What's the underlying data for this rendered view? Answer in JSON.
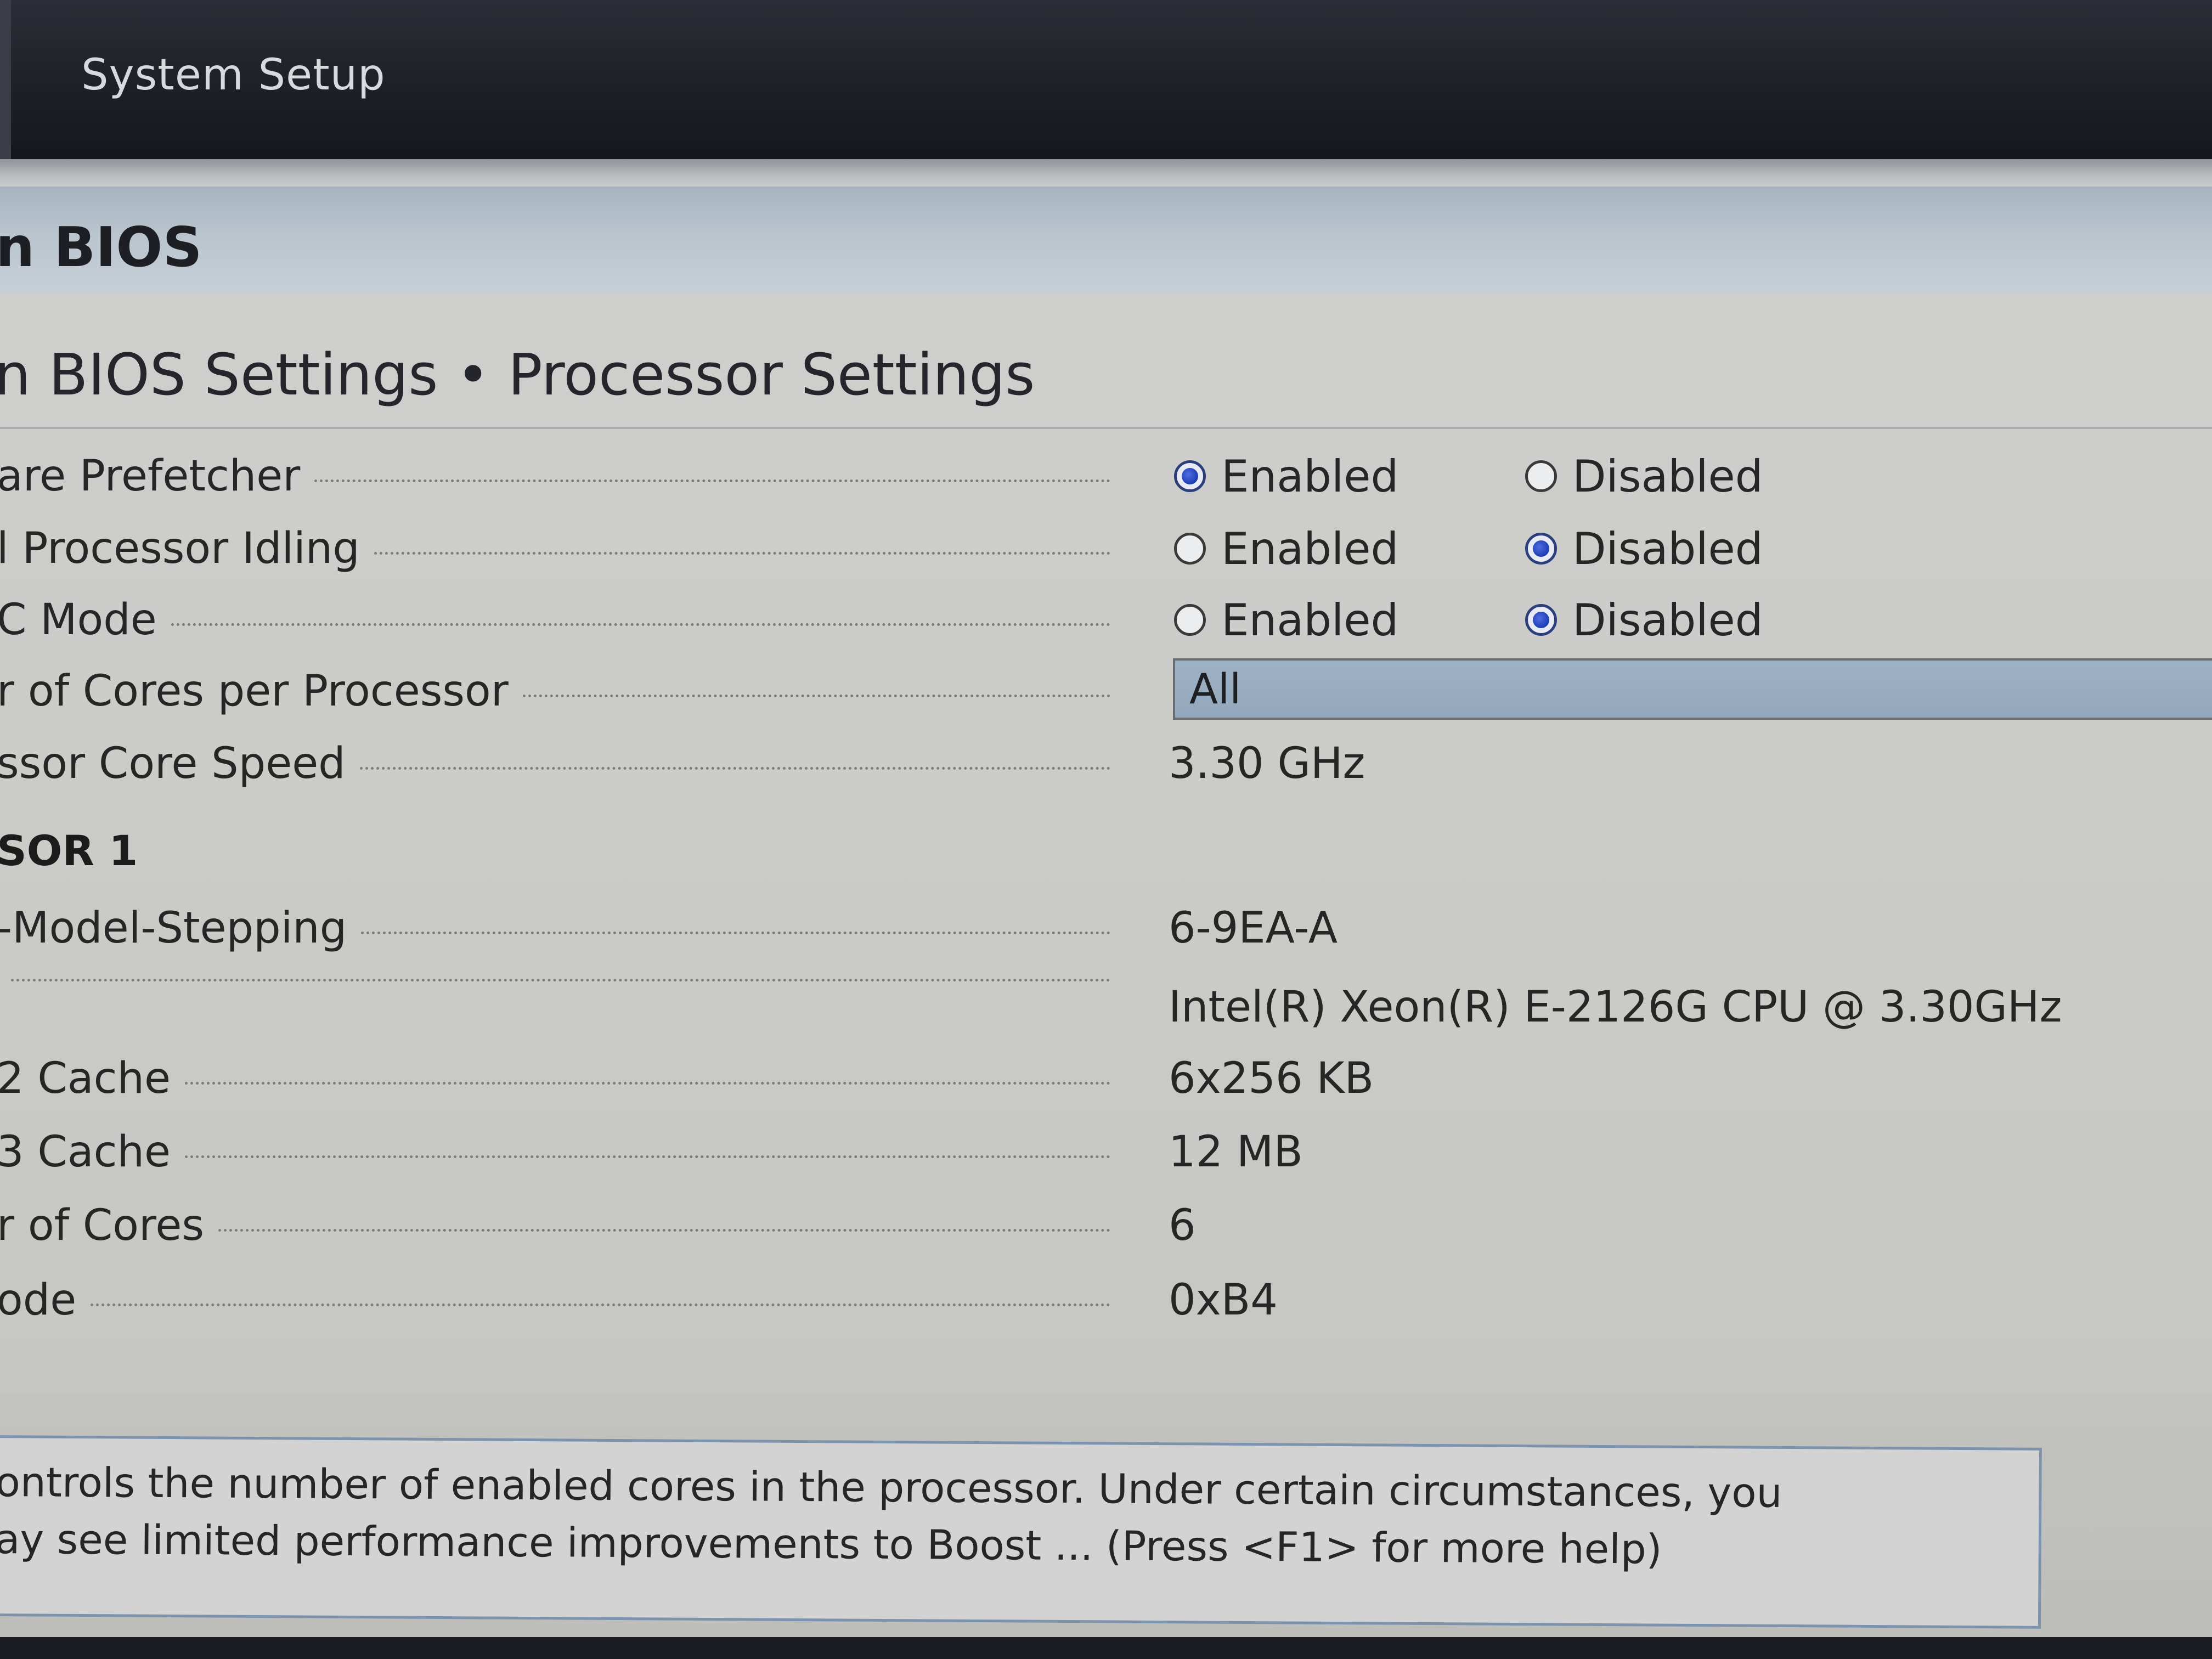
{
  "window": {
    "title": "System Setup"
  },
  "section": {
    "title": "n BIOS"
  },
  "breadcrumb": {
    "text": "n BIOS Settings • Processor Settings"
  },
  "settings": [
    {
      "label": "are Prefetcher",
      "type": "radio",
      "options": [
        "Enabled",
        "Disabled"
      ],
      "selected": "Enabled"
    },
    {
      "label": "l Processor Idling",
      "type": "radio",
      "options": [
        "Enabled",
        "Disabled"
      ],
      "selected": "Disabled"
    },
    {
      "label": "C Mode",
      "type": "radio",
      "options": [
        "Enabled",
        "Disabled"
      ],
      "selected": "Disabled"
    },
    {
      "label": "r of Cores per Processor",
      "type": "dropdown",
      "value": "All"
    },
    {
      "label": "ssor Core Speed",
      "type": "text",
      "value": "3.30 GHz"
    }
  ],
  "processor_group": {
    "header": "SOR 1",
    "rows": [
      {
        "label": "-Model-Stepping",
        "value": "6-9EA-A"
      },
      {
        "label": "",
        "value": "Intel(R) Xeon(R) E-2126G CPU @ 3.30GHz"
      },
      {
        "label": "2 Cache",
        "value": "6x256 KB"
      },
      {
        "label": "3 Cache",
        "value": "12 MB"
      },
      {
        "label": "r of Cores",
        "value": "6"
      },
      {
        "label": "ode",
        "value": "0xB4"
      }
    ]
  },
  "help": {
    "line1": "ontrols the number of enabled cores in the processor. Under certain circumstances, you",
    "line2": "ay see limited performance improvements to Boost ... (Press <F1> for more help)"
  }
}
